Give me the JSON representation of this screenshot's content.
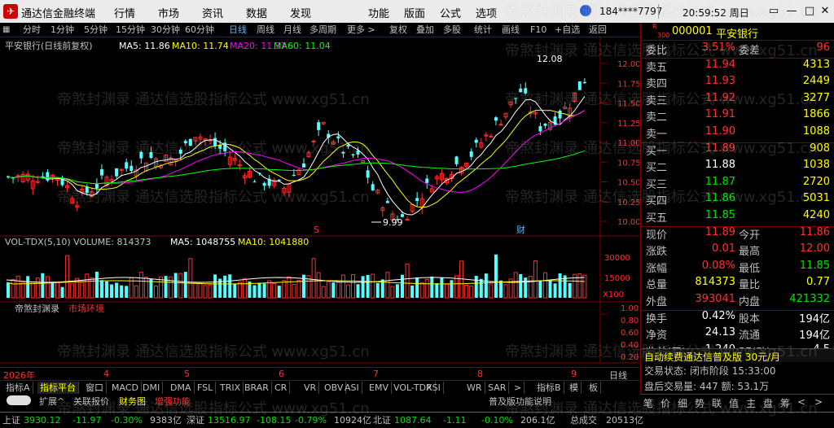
{
  "title_bar": {
    "app_title": "通达信金融终端",
    "menus": [
      "行情",
      "市场",
      "资讯",
      "数据",
      "发现",
      "功能",
      "版面",
      "公式",
      "选项"
    ],
    "account": "184****7797",
    "clock": "20:59:52 周日"
  },
  "toolbar": {
    "items": [
      "分时",
      "1分钟",
      "5分钟",
      "15分钟",
      "30分钟",
      "60分钟",
      "日线",
      "周线",
      "月线",
      "多周期",
      "更多 >",
      "复权",
      "叠加",
      "多股",
      "统计",
      "画线",
      "F10",
      "+自选",
      "返回"
    ],
    "active": "日线"
  },
  "main_chart": {
    "stock_label": "平安银行(日线前复权)",
    "ma": [
      {
        "label": "MA5: 11.86",
        "color": "#ffffff"
      },
      {
        "label": "MA10: 11.74",
        "color": "#ffff00"
      },
      {
        "label": "MA20: 11.37",
        "color": "#ff00ff"
      },
      {
        "label": "MA60: 11.04",
        "color": "#00ff00"
      }
    ],
    "price_ticks": [
      "12.00",
      "11.75",
      "11.50",
      "11.25",
      "11.00",
      "10.75",
      "10.50",
      "10.25",
      "10.00"
    ],
    "high_marker": "12.08",
    "low_marker": "9.99",
    "event_s": "S",
    "event_cai": "财"
  },
  "volume_chart": {
    "label": "VOL-TDX(5,10) VOLUME: 814373",
    "ma5": "MA5: 1048755",
    "ma10": "MA10: 1041880",
    "ticks": [
      "30000",
      "15000"
    ],
    "unit": "X100"
  },
  "sub_chart": {
    "label": "帝煞封渊录",
    "sub_label": "市场环境",
    "ticks": [
      "1.00",
      "0.80",
      "0.60",
      "0.40",
      "0.20"
    ]
  },
  "date_axis": {
    "year": "2026年",
    "months": [
      "4",
      "5",
      "6",
      "7",
      "8",
      "9"
    ],
    "period": "日线"
  },
  "right_panel": {
    "code": "000001",
    "name": "平安银行",
    "small_tag": "R",
    "small_num": "300",
    "weibi_label": "委比",
    "weibi_value": "3.51%",
    "weicha_label": "委差",
    "weicha_value": "96",
    "sells": [
      {
        "label": "卖五",
        "price": "11.94",
        "vol": "4313"
      },
      {
        "label": "卖四",
        "price": "11.93",
        "vol": "2449"
      },
      {
        "label": "卖三",
        "price": "11.92",
        "vol": "3277"
      },
      {
        "label": "卖二",
        "price": "11.91",
        "vol": "1866"
      },
      {
        "label": "卖一",
        "price": "11.90",
        "vol": "1088"
      }
    ],
    "buys": [
      {
        "label": "买一",
        "price": "11.89",
        "vol": "908"
      },
      {
        "label": "买二",
        "price": "11.88",
        "vol": "1038"
      },
      {
        "label": "买三",
        "price": "11.87",
        "vol": "2720"
      },
      {
        "label": "买四",
        "price": "11.86",
        "vol": "5031"
      },
      {
        "label": "买五",
        "price": "11.85",
        "vol": "4240"
      }
    ],
    "stats": [
      {
        "l1": "现价",
        "v1": "11.89",
        "l2": "今开",
        "v2": "11.86"
      },
      {
        "l1": "涨跌",
        "v1": "0.01",
        "l2": "最高",
        "v2": "12.00"
      },
      {
        "l1": "涨幅",
        "v1": "0.08%",
        "l2": "最低",
        "v2": "11.85"
      },
      {
        "l1": "总量",
        "v1": "814373",
        "l2": "量比",
        "v2": "0.77"
      },
      {
        "l1": "外盘",
        "v1": "393041",
        "l2": "内盘",
        "v2": "421332"
      }
    ],
    "stats2": [
      {
        "l1": "换手",
        "v1": "0.42%",
        "l2": "股本",
        "v2": "194亿"
      },
      {
        "l1": "净资",
        "v1": "24.13",
        "l2": "流通",
        "v2": "194亿"
      },
      {
        "l1": "收益(三)",
        "v1": "1.240",
        "l2": "PE(动)",
        "v2": "4.5"
      }
    ],
    "promo": "自动续费通达信普及版 30元/月",
    "trade_status": "交易状态: 闭市阶段 15:33:00",
    "after_hours": "盘后交易量: 447  额: 53.1万",
    "bottom_tabs": [
      "笔",
      "价",
      "细",
      "势",
      "联",
      "值",
      "主",
      "盘",
      "筹",
      "<",
      ">"
    ]
  },
  "bottom_tabs": {
    "row1": [
      "指标A",
      "指标平台",
      "窗口",
      "MACD",
      "DMI",
      "DMA",
      "FSL",
      "TRIX",
      "BRAR",
      "CR",
      "VR",
      "OBV",
      "ASI",
      "EMV",
      "VOL-TDX",
      "RSI",
      "WR",
      "SAR",
      ">",
      "指标B",
      "模",
      "板"
    ],
    "row1_active": "指标平台",
    "row2": [
      "扩展^",
      "关联报价",
      "财务图",
      "增强功能"
    ],
    "row2_right": "普及版功能说明"
  },
  "status_bar": {
    "items": [
      {
        "name": "上证",
        "value": "3930.12",
        "chg": "-11.97",
        "pct": "-0.30%",
        "amt": "9383亿"
      },
      {
        "name": "深证",
        "value": "13516.97",
        "chg": "-108.15",
        "pct": "-0.79%",
        "amt": "10924亿"
      },
      {
        "name": "北证",
        "value": "1087.64",
        "chg": "-1.11",
        "pct": "-0.10%",
        "amt": "206.1亿"
      }
    ],
    "total_label": "总成交",
    "total_value": "20513亿"
  },
  "watermark": "帝煞封渊录  通达信选股指标公式 www.xg51.cn"
}
